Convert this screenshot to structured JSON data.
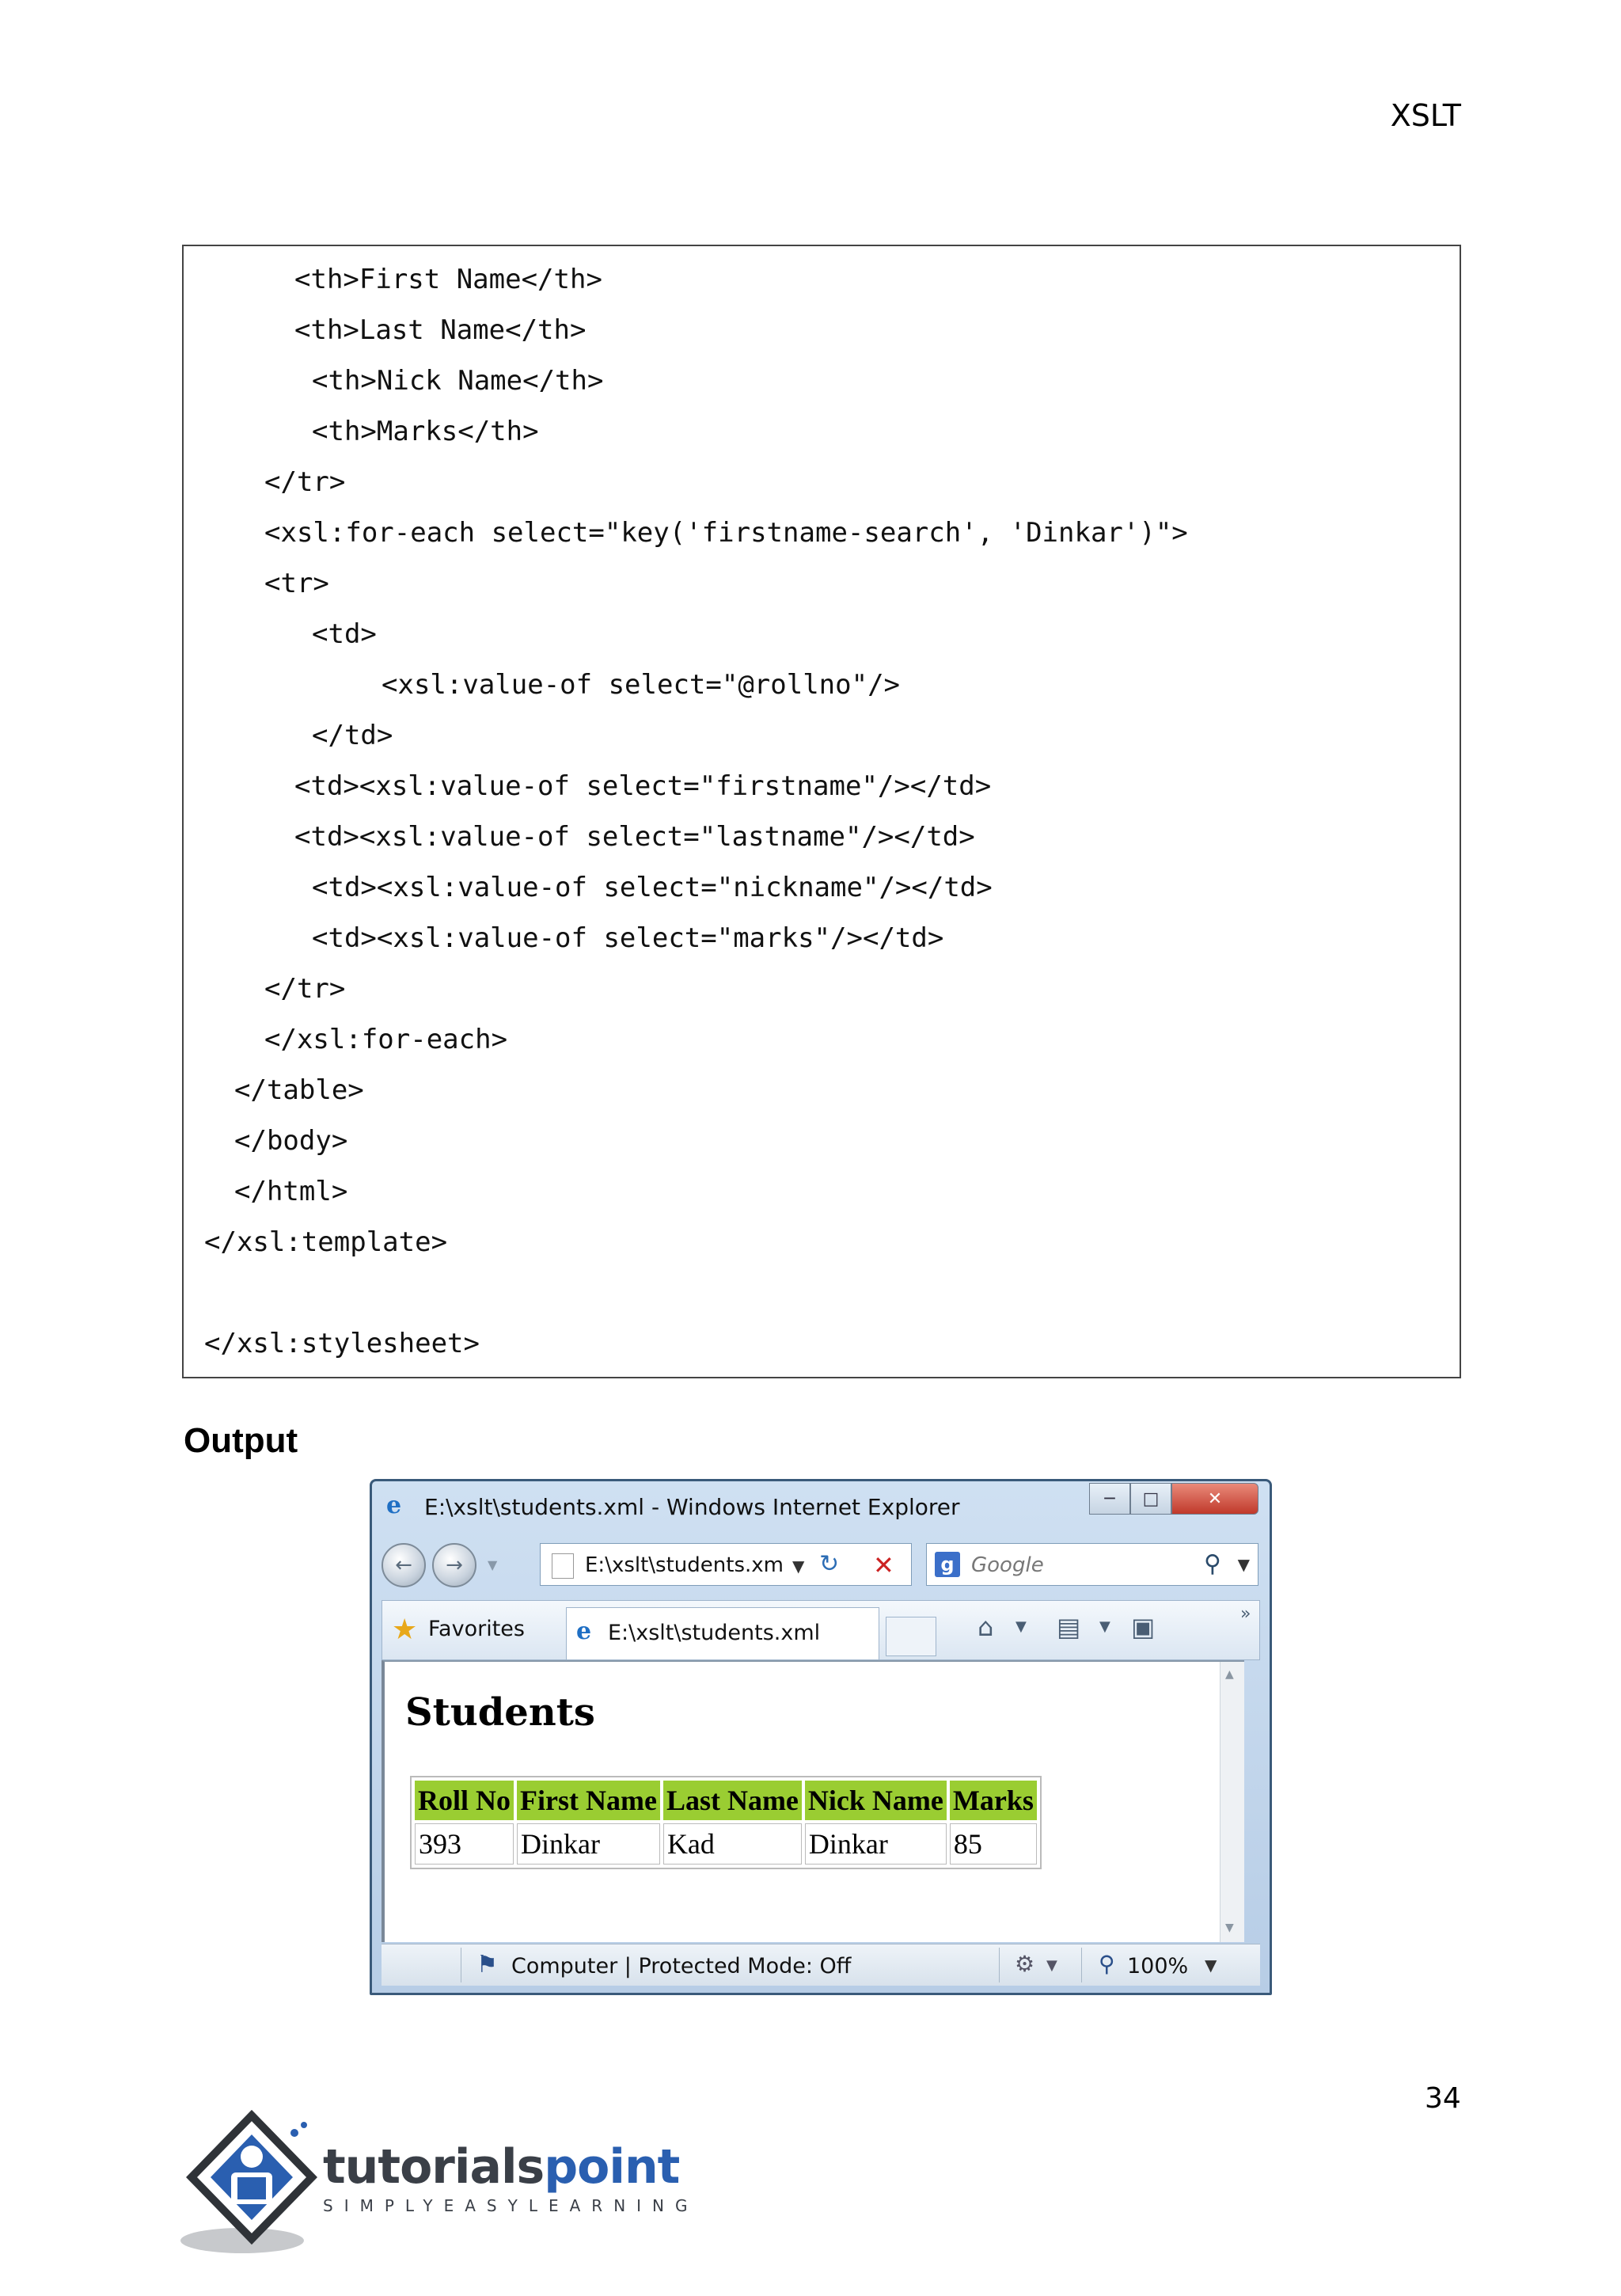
{
  "header": {
    "title": "XSLT"
  },
  "code_lines": [
    "<th>First Name</th>",
    "<th>Last Name</th>",
    "<th>Nick Name</th>",
    "<th>Marks</th>",
    "</tr>",
    "<xsl:for-each select=\"key('firstname-search', 'Dinkar')\">",
    "<tr>",
    "<td>",
    "<xsl:value-of select=\"@rollno\"/>",
    "</td>",
    "<td><xsl:value-of select=\"firstname\"/></td>",
    "<td><xsl:value-of select=\"lastname\"/></td>",
    "<td><xsl:value-of select=\"nickname\"/></td>",
    "<td><xsl:value-of select=\"marks\"/></td>",
    "</tr>",
    "</xsl:for-each>",
    "</table>",
    "</body>",
    "</html>",
    "</xsl:template>",
    "</xsl:stylesheet>"
  ],
  "output_heading": "Output",
  "browser": {
    "window_title": "E:\\xslt\\students.xml - Windows Internet Explorer",
    "address": "E:\\xslt\\students.xm",
    "search_placeholder": "Google",
    "favorites_label": "Favorites",
    "tab_title": "E:\\xslt\\students.xml",
    "status_text": "Computer | Protected Mode: Off",
    "zoom": "100%",
    "icons": [
      "ie-logo-icon",
      "back-icon",
      "forward-icon",
      "refresh-icon",
      "stop-icon",
      "google-icon",
      "search-icon",
      "star-icon",
      "home-icon",
      "feeds-icon",
      "print-icon",
      "computer-icon",
      "zoom-icon"
    ],
    "page": {
      "heading": "Students",
      "table": {
        "headers": [
          "Roll No",
          "First Name",
          "Last Name",
          "Nick Name",
          "Marks"
        ],
        "rows": [
          [
            "393",
            "Dinkar",
            "Kad",
            "Dinkar",
            "85"
          ]
        ]
      }
    }
  },
  "page_number": "34",
  "logo": {
    "name_part1": "tutorials",
    "name_part2": "point",
    "tagline": "SIMPLYEASYLEARNING"
  },
  "colors": {
    "table_header_bg": "#9acd32",
    "logo_blue": "#2a5fb0",
    "logo_dark": "#3a3f47"
  }
}
